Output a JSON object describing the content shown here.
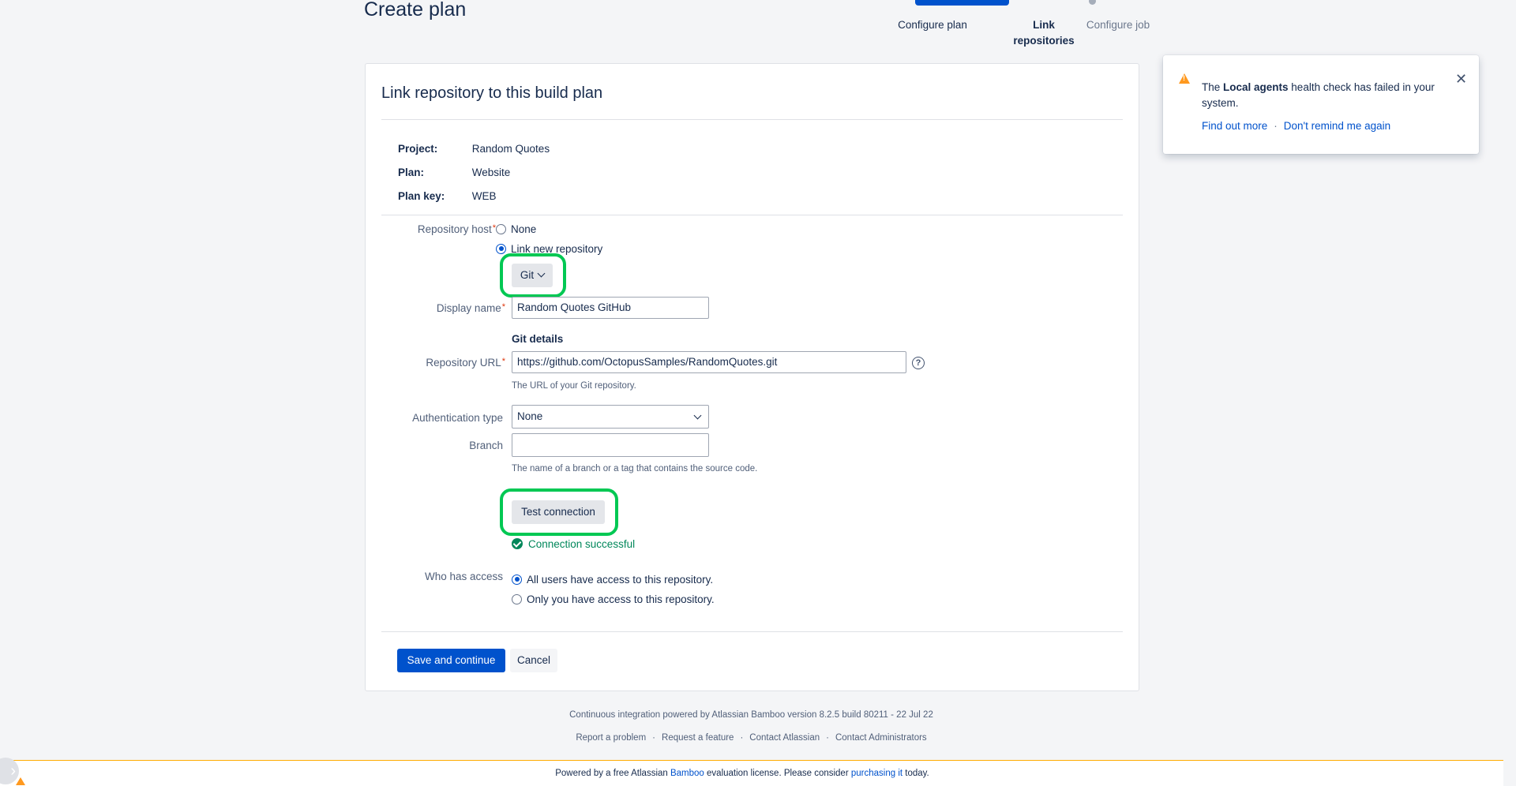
{
  "page": {
    "title": "Create plan"
  },
  "wizard": {
    "steps": [
      {
        "label": "Configure plan"
      },
      {
        "label": "Link repositories"
      },
      {
        "label": "Configure job"
      }
    ]
  },
  "card": {
    "title": "Link repository to this build plan",
    "info": {
      "project_key": "Project:",
      "project_val": "Random Quotes",
      "plan_key": "Plan:",
      "plan_val": "Website",
      "plankey_key": "Plan key:",
      "plankey_val": "WEB"
    }
  },
  "form": {
    "repo_host_label": "Repository host",
    "repo_host_none": "None",
    "repo_host_link": "Link new repository",
    "repo_type_btn": "Git",
    "display_name_label": "Display name",
    "display_name_value": "Random Quotes GitHub",
    "git_details_head": "Git details",
    "repo_url_label": "Repository URL",
    "repo_url_value": "https://github.com/OctopusSamples/RandomQuotes.git",
    "repo_url_help": "The URL of your Git repository.",
    "auth_label": "Authentication type",
    "auth_value": "None",
    "branch_label": "Branch",
    "branch_value": "",
    "branch_help": "The name of a branch or a tag that contains the source code.",
    "test_btn": "Test connection",
    "connection_status": "Connection successful",
    "access_label": "Who has access",
    "access_all": "All users have access to this repository.",
    "access_only": "Only you have access to this repository.",
    "save_btn": "Save and continue",
    "cancel_btn": "Cancel"
  },
  "notification": {
    "text_pre": "The ",
    "text_bold": "Local agents",
    "text_post": " health check has failed in your system.",
    "link1": "Find out more",
    "link2": "Don't remind me again"
  },
  "footer": {
    "powered": "Continuous integration powered by Atlassian Bamboo version 8.2.5 build 80211 - 22 Jul 22",
    "links": [
      "Report a problem",
      "Request a feature",
      "Contact Atlassian",
      "Contact Administrators"
    ],
    "license_pre": "Powered by a free Atlassian ",
    "license_link1": "Bamboo",
    "license_mid": " evaluation license. Please consider ",
    "license_link2": "purchasing it",
    "license_post": " today."
  },
  "colors": {
    "primary": "#0052cc",
    "success": "#00875a",
    "highlight": "#00c853",
    "warning": "#ff991f"
  }
}
